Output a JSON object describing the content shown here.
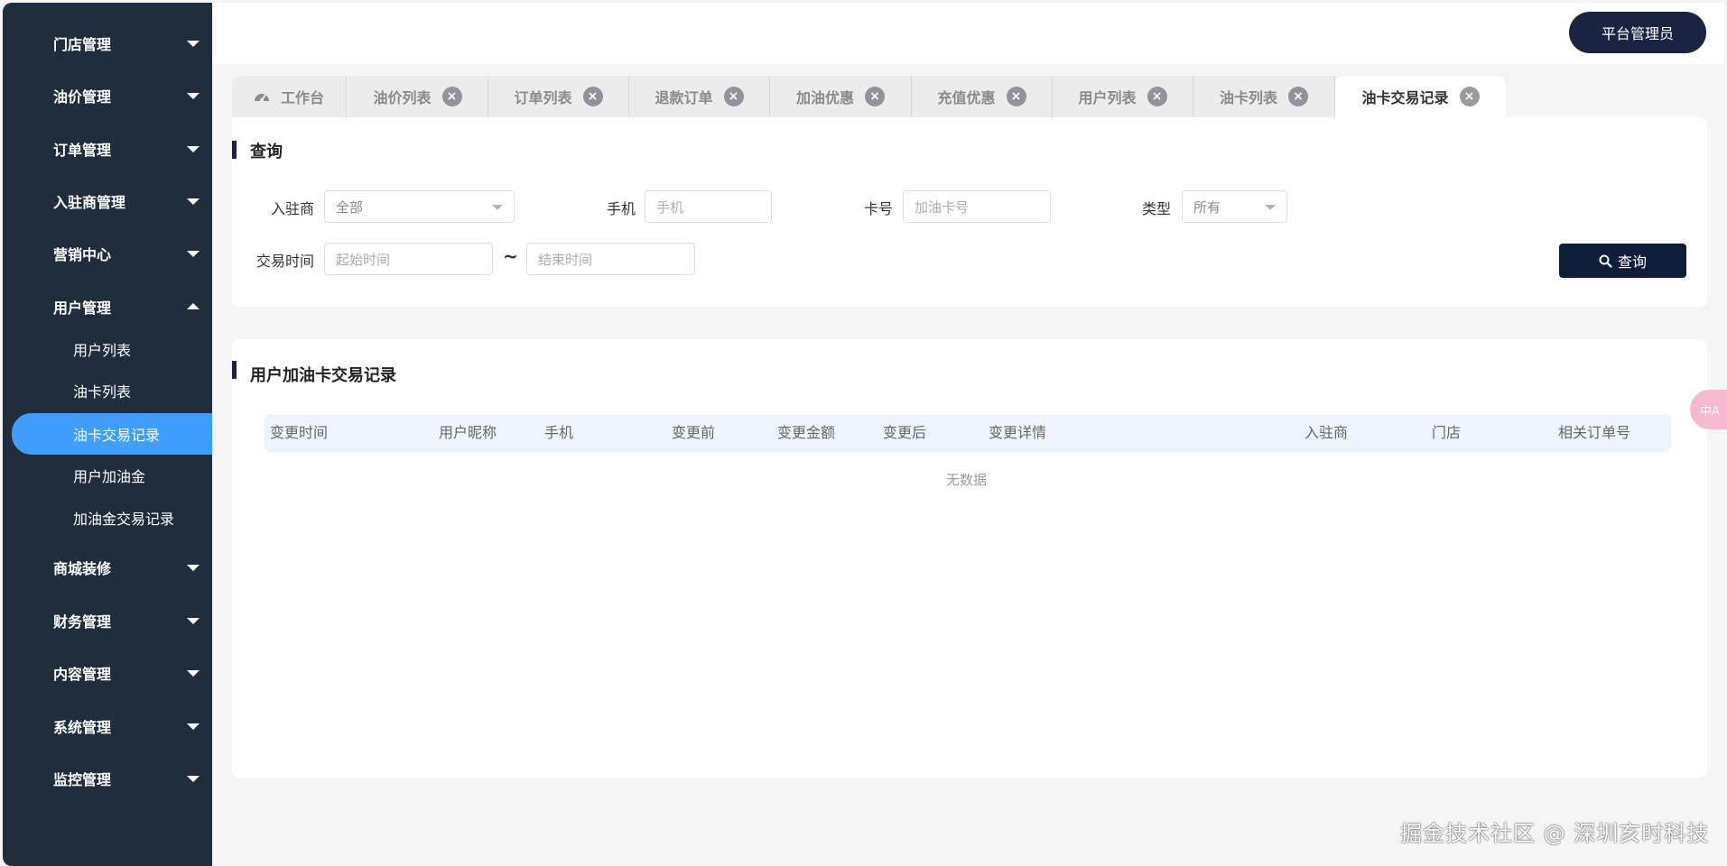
{
  "sidebar": {
    "menu": [
      {
        "label": "门店管理"
      },
      {
        "label": "油价管理"
      },
      {
        "label": "订单管理"
      },
      {
        "label": "入驻商管理"
      },
      {
        "label": "营销中心"
      },
      {
        "label": "用户管理"
      },
      {
        "label": "商城装修"
      },
      {
        "label": "财务管理"
      },
      {
        "label": "内容管理"
      },
      {
        "label": "系统管理"
      },
      {
        "label": "监控管理"
      }
    ],
    "user_sub": [
      {
        "label": "用户列表"
      },
      {
        "label": "油卡列表"
      },
      {
        "label": "油卡交易记录"
      },
      {
        "label": "用户加油金"
      },
      {
        "label": "加油金交易记录"
      }
    ]
  },
  "header": {
    "admin_label": "平台管理员"
  },
  "tabs": [
    {
      "label": "工作台"
    },
    {
      "label": "油价列表"
    },
    {
      "label": "订单列表"
    },
    {
      "label": "退款订单"
    },
    {
      "label": "加油优惠"
    },
    {
      "label": "充值优惠"
    },
    {
      "label": "用户列表"
    },
    {
      "label": "油卡列表"
    },
    {
      "label": "油卡交易记录"
    }
  ],
  "query": {
    "title": "查询",
    "merchant_label": "入驻商",
    "merchant_value": "全部",
    "phone_label": "手机",
    "phone_placeholder": "手机",
    "card_label": "卡号",
    "card_placeholder": "加油卡号",
    "type_label": "类型",
    "type_value": "所有",
    "time_label": "交易时间",
    "start_placeholder": "起始时间",
    "range_sep": "~",
    "end_placeholder": "结束时间",
    "search_button": "查询"
  },
  "records": {
    "title": "用户加油卡交易记录",
    "columns": [
      "变更时间",
      "用户昵称",
      "手机",
      "变更前",
      "变更金额",
      "变更后",
      "变更详情",
      "入驻商",
      "门店",
      "相关订单号"
    ],
    "empty_text": "无数据"
  },
  "overlay": {
    "translate_label": "中A",
    "watermark": "掘金技术社区 @ 深圳亥时科技"
  }
}
